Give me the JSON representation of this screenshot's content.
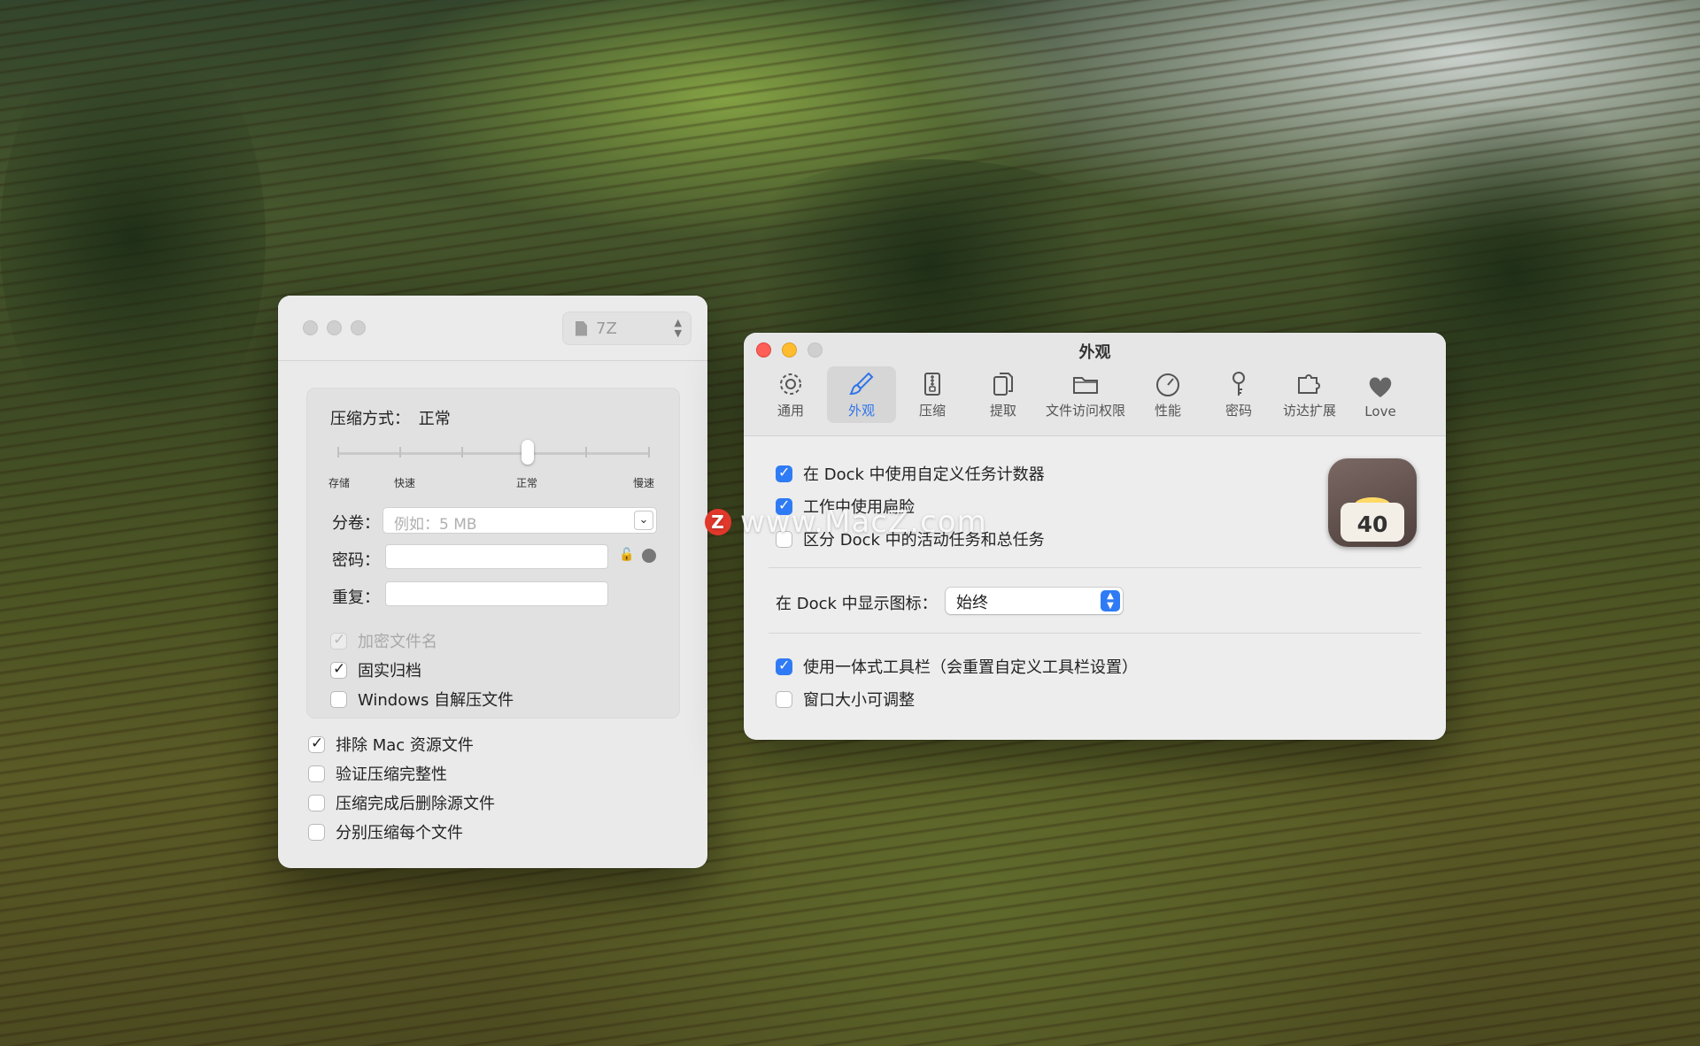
{
  "left_window": {
    "format_select": {
      "value": "7Z",
      "icon": "file-icon"
    },
    "compression": {
      "label": "压缩方式：",
      "value": "正常",
      "level_index": 3,
      "tick_labels": [
        "存储",
        "快速",
        "正常",
        "慢速"
      ]
    },
    "split": {
      "label": "分卷：",
      "placeholder": "例如：5 MB"
    },
    "password": {
      "label": "密码：",
      "value": ""
    },
    "repeat": {
      "label": "重复：",
      "value": ""
    },
    "options_inner": [
      {
        "label": "加密文件名",
        "checked": true,
        "disabled": true
      },
      {
        "label": "固实归档",
        "checked": true,
        "disabled": false
      },
      {
        "label": "Windows 自解压文件",
        "checked": false,
        "disabled": false
      }
    ],
    "options_outer": [
      {
        "label": "排除 Mac 资源文件",
        "checked": true
      },
      {
        "label": "验证压缩完整性",
        "checked": false
      },
      {
        "label": "压缩完成后删除源文件",
        "checked": false
      },
      {
        "label": "分别压缩每个文件",
        "checked": false
      }
    ]
  },
  "right_window": {
    "title": "外观",
    "toolbar": [
      {
        "label": "通用",
        "icon": "gear-icon"
      },
      {
        "label": "外观",
        "icon": "brush-icon",
        "active": true
      },
      {
        "label": "压缩",
        "icon": "zip-icon"
      },
      {
        "label": "提取",
        "icon": "extract-icon"
      },
      {
        "label": "文件访问权限",
        "icon": "folder-icon"
      },
      {
        "label": "性能",
        "icon": "speedometer-icon"
      },
      {
        "label": "密码",
        "icon": "key-icon"
      },
      {
        "label": "访达扩展",
        "icon": "puzzle-icon"
      },
      {
        "label": "Love",
        "icon": "heart-icon"
      }
    ],
    "options_top": [
      {
        "label": "在 Dock 中使用自定义任务计数器",
        "checked": true
      },
      {
        "label": "工作中使用扁脸",
        "checked": true
      },
      {
        "label": "区分 Dock 中的活动任务和总任务",
        "checked": false
      }
    ],
    "dock_icon": {
      "label": "在 Dock 中显示图标：",
      "value": "始终"
    },
    "app_icon_badge": "40",
    "options_bottom": [
      {
        "label": "使用一体式工具栏（会重置自定义工具栏设置）",
        "checked": true
      },
      {
        "label": "窗口大小可调整",
        "checked": false
      }
    ]
  },
  "watermark": {
    "logo_letter": "Z",
    "text": "www.MacZ.com"
  },
  "colors": {
    "accent": "#2f7bf5",
    "close": "#fe5f57",
    "minimize": "#febc2e",
    "zoom_inactive": "#cfcfcf"
  }
}
